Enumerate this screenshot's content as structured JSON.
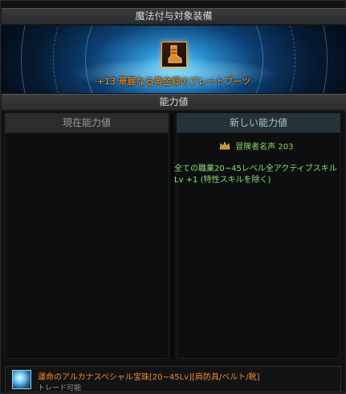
{
  "header_top": "魔法付与対象装備",
  "header_mid": "能力値",
  "target_item": {
    "name": "+13 華麗なる黄金郷のプレートブーツ",
    "icon": "boots-icon",
    "color": "#ff9a2a"
  },
  "columns": {
    "current": "現在能力値",
    "new": "新しい能力値"
  },
  "adventurer": {
    "icon": "crown-icon",
    "label": "冒険者名声",
    "value": "203"
  },
  "effect_text": "全ての職業20~45レベル全アクティブスキル Lv +1 (特性スキルを除く)",
  "jewel": {
    "icon": "jewel-icon",
    "name": "運命のアルカナスペシャル宝珠[20~45Lv][肩防具/ベルト/靴]",
    "trade": "トレード可能"
  }
}
